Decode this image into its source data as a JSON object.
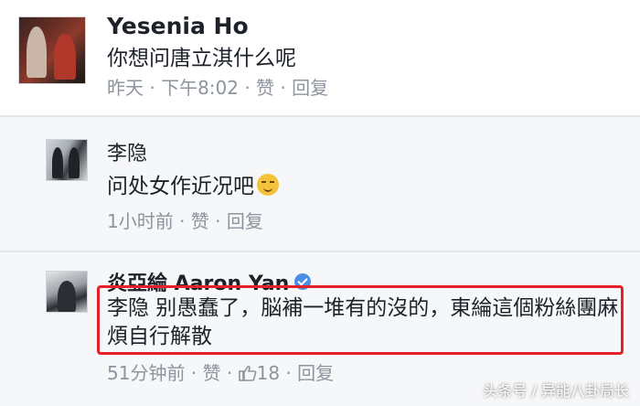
{
  "comments": [
    {
      "author": "Yesenia Ho",
      "text": "你想问唐立淇什么呢",
      "meta": "昨天 · 下午8:02 · 赞 · 回复"
    },
    {
      "author": "李隐",
      "text": "问处女作近况吧",
      "meta": "1小时前 · 赞 · 回复"
    },
    {
      "author": "炎亞綸 Aaron Yan",
      "text": "李隐 别愚蠢了，脳補一堆有的沒的，東綸這個粉絲團麻煩自行解散",
      "meta_time": "51分钟前 · 赞 · ",
      "meta_likes": "18",
      "meta_reply": " · 回复"
    }
  ],
  "icons": {
    "emoji": "smirk-emoji-icon",
    "verified": "verified-badge-icon",
    "like": "thumbs-up-icon"
  },
  "watermark": "头条号 / 异能八卦局长",
  "colors": {
    "highlight_border": "#e5202a",
    "verified_blue": "#4a90e2",
    "meta_gray": "#8d949e"
  }
}
